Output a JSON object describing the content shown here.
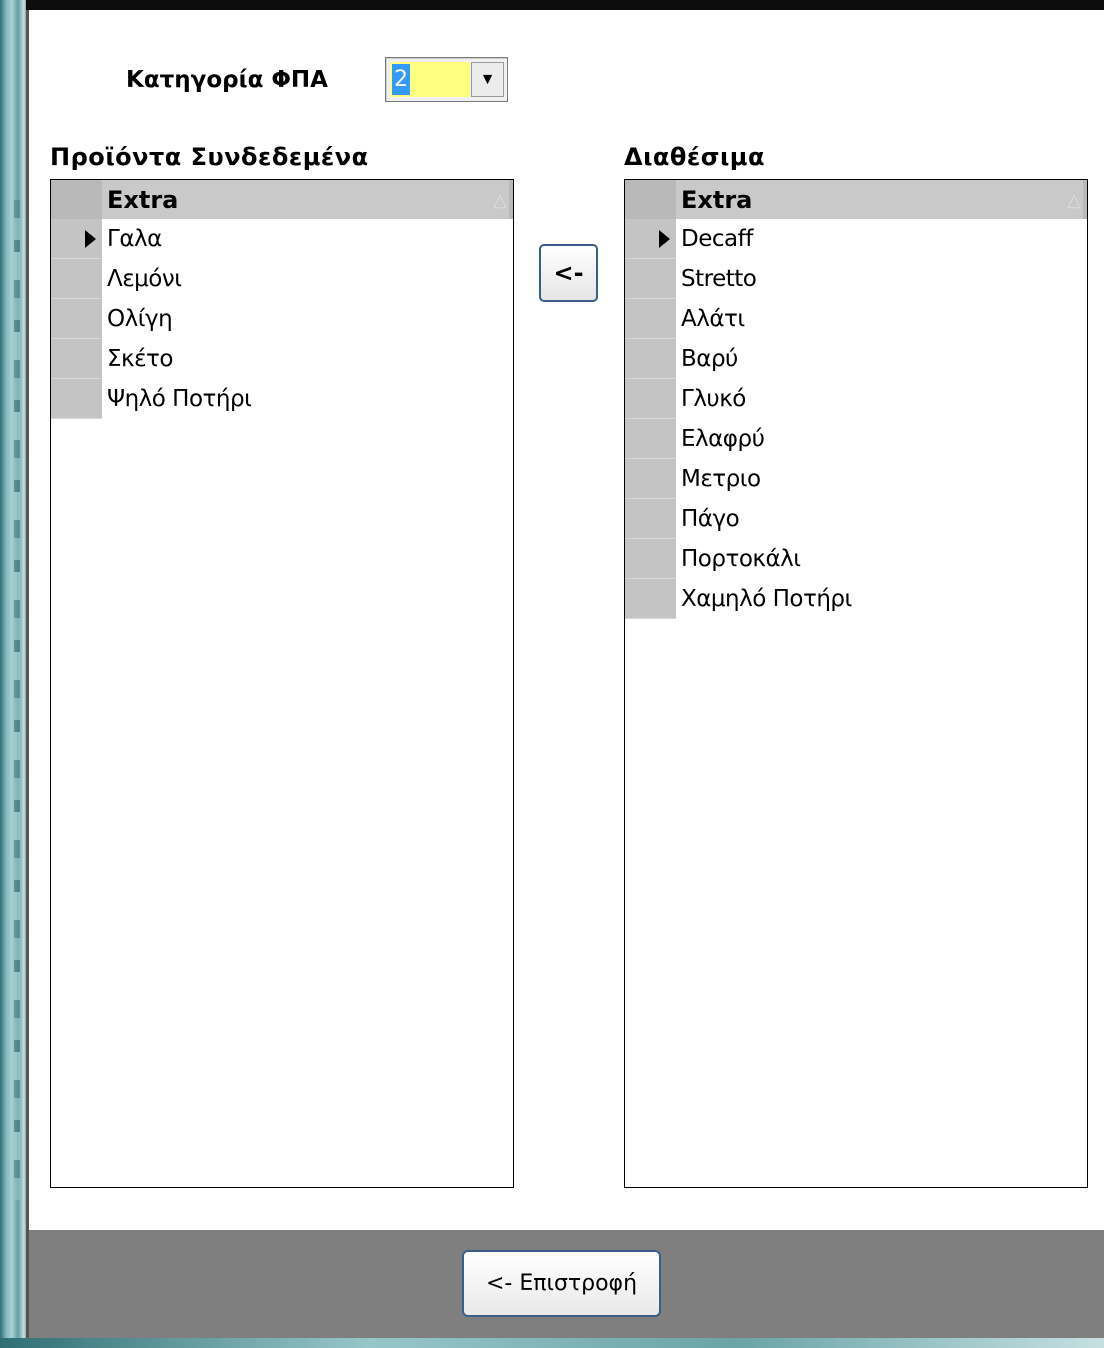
{
  "vat": {
    "label": "Κατηγορία ΦΠΑ",
    "value": "2",
    "dropdown_icon": "chevron-down-icon"
  },
  "linked_panel": {
    "title": "Προϊόντα   Συνδεδεμένα",
    "column_header": "Extra",
    "sort_icon": "△",
    "items": [
      "Γαλα",
      "Λεμόνι",
      "Ολίγη",
      "Σκέτο",
      "Ψηλό Ποτήρι"
    ],
    "selected_index": 0
  },
  "available_panel": {
    "title": "Διαθέσιμα",
    "column_header": "Extra",
    "sort_icon": "△",
    "items": [
      "Decaff",
      "Stretto",
      "Αλάτι",
      "Βαρύ",
      "Γλυκό",
      "Ελαφρύ",
      "Μετριο",
      "Πάγο",
      "Πορτοκάλι",
      "Χαμηλό Ποτήρι"
    ],
    "selected_index": 0
  },
  "actions": {
    "move_label": "<-",
    "return_label": "<- Επιστροφή"
  },
  "colors": {
    "combo_bg": "#ffff80",
    "selection": "#3399ff",
    "footer": "#7f7f7f",
    "row_header": "#c4c4c4"
  }
}
